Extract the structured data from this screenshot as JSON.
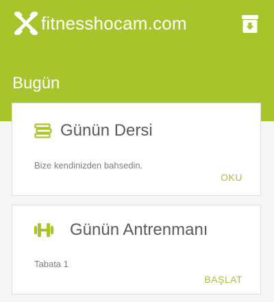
{
  "header": {
    "site_name": "fitnesshocam.com",
    "logo_icon": "dumbbell-cross-icon",
    "archive_icon": "archive-download-icon"
  },
  "section": {
    "title": "Bugün"
  },
  "lesson_card": {
    "icon": "books-icon",
    "title": "Günün Dersi",
    "description": "Bize kendinizden bahsedin.",
    "action_label": "OKU"
  },
  "workout_card": {
    "icon": "dumbbell-icon",
    "title": "Günün Antrenmanı",
    "description": "Tabata 1",
    "action_label": "BAŞLAT"
  },
  "colors": {
    "accent": "#a6c52a",
    "card_bg": "#ffffff",
    "page_bg": "#f4f5f7"
  }
}
